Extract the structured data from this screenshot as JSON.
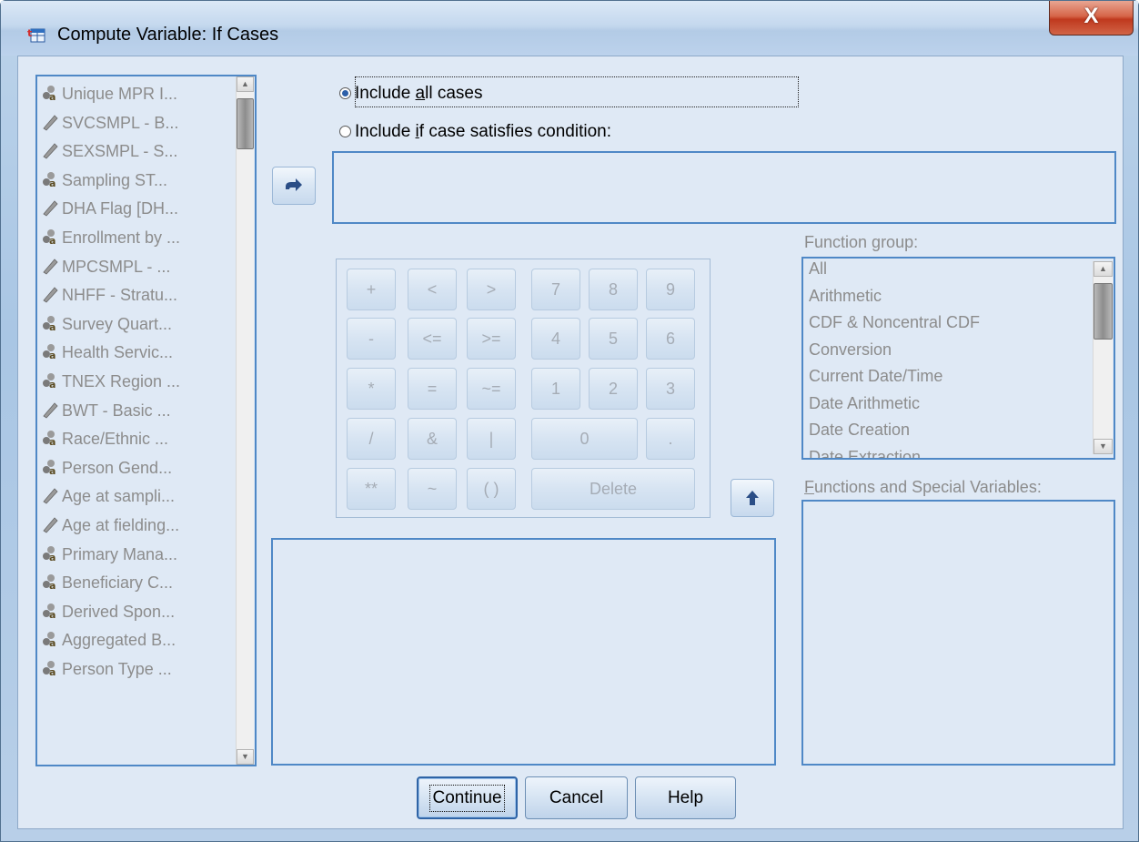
{
  "window": {
    "title": "Compute Variable: If Cases",
    "close_label": "X"
  },
  "variables": [
    {
      "label": "Unique MPR I...",
      "icon": "nominal-icon"
    },
    {
      "label": "SVCSMPL - B...",
      "icon": "scale-icon"
    },
    {
      "label": "SEXSMPL - S...",
      "icon": "scale-icon"
    },
    {
      "label": "Sampling ST...",
      "icon": "nominal-icon"
    },
    {
      "label": "DHA Flag [DH...",
      "icon": "scale-icon"
    },
    {
      "label": "Enrollment by ...",
      "icon": "nominal-icon"
    },
    {
      "label": "MPCSMPL - ...",
      "icon": "scale-icon"
    },
    {
      "label": "NHFF - Stratu...",
      "icon": "scale-icon"
    },
    {
      "label": "Survey Quart...",
      "icon": "nominal-icon"
    },
    {
      "label": "Health Servic...",
      "icon": "nominal-icon"
    },
    {
      "label": "TNEX Region ...",
      "icon": "nominal-icon"
    },
    {
      "label": "BWT - Basic ...",
      "icon": "scale-icon"
    },
    {
      "label": "Race/Ethnic ...",
      "icon": "nominal-icon"
    },
    {
      "label": "Person Gend...",
      "icon": "nominal-icon"
    },
    {
      "label": "Age at sampli...",
      "icon": "scale-icon"
    },
    {
      "label": "Age at fielding...",
      "icon": "scale-icon"
    },
    {
      "label": "Primary Mana...",
      "icon": "nominal-icon"
    },
    {
      "label": "Beneficiary C...",
      "icon": "nominal-icon"
    },
    {
      "label": "Derived Spon...",
      "icon": "nominal-icon"
    },
    {
      "label": "Aggregated B...",
      "icon": "nominal-icon"
    },
    {
      "label": "Person Type ...",
      "icon": "nominal-icon"
    }
  ],
  "radios": {
    "all_cases": {
      "pre": "Include ",
      "mnemonic": "a",
      "post": "ll cases",
      "selected": true
    },
    "if_condition": {
      "pre": "Include ",
      "mnemonic": "i",
      "post": "f case satisfies condition:",
      "selected": false
    }
  },
  "keypad": {
    "keys": [
      "+",
      "<",
      ">",
      "7",
      "8",
      "9",
      "-",
      "<=",
      ">=",
      "4",
      "5",
      "6",
      "*",
      "=",
      "~=",
      "1",
      "2",
      "3",
      "/",
      "&",
      "|",
      "0",
      ".",
      "**",
      "~",
      "( )",
      "Delete"
    ]
  },
  "function_group": {
    "label_pre": "Function ",
    "label_mnemonic": "g",
    "label_post": "roup:",
    "items": [
      "All",
      "Arithmetic",
      "CDF & Noncentral CDF",
      "Conversion",
      "Current Date/Time",
      "Date Arithmetic",
      "Date Creation",
      "Date Extraction"
    ]
  },
  "functions": {
    "label_mnemonic": "F",
    "label_post": "unctions and Special Variables:"
  },
  "buttons": {
    "continue": "Continue",
    "cancel": "Cancel",
    "help": "Help"
  },
  "colors": {
    "selected_radio": "#2d5fa8",
    "list_border": "#4f88c6",
    "disabled_text": "#8c8c8c",
    "close_button": "#c0391e"
  }
}
